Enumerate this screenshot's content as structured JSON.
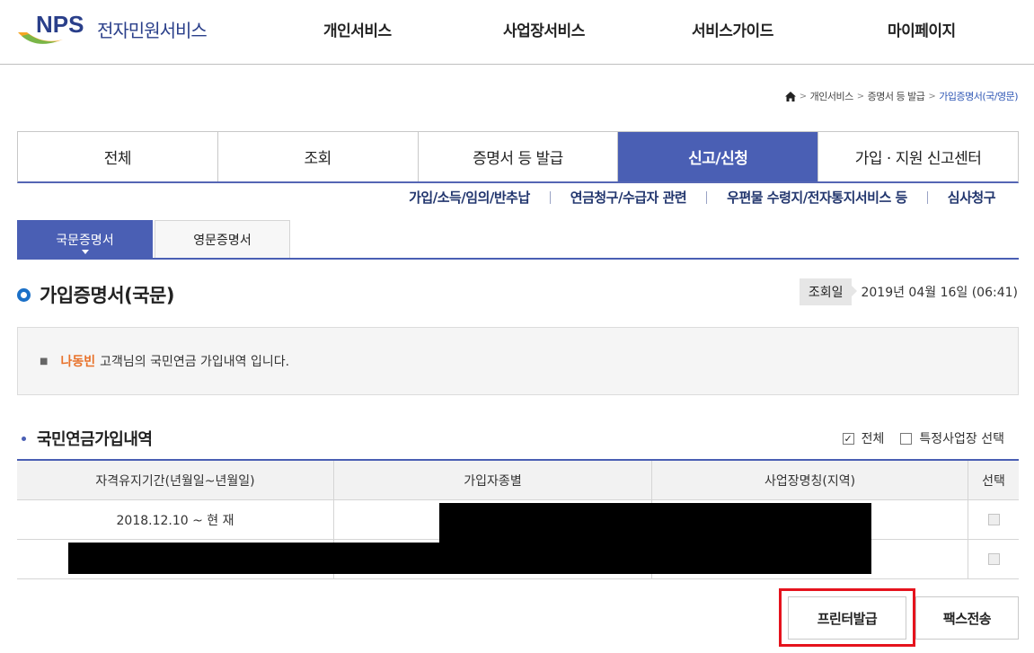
{
  "header": {
    "logo_mark": "NPS",
    "logo_text": "전자민원서비스",
    "nav": [
      "개인서비스",
      "사업장서비스",
      "서비스가이드",
      "마이페이지"
    ]
  },
  "breadcrumb": {
    "items": [
      "개인서비스",
      "증명서 등 발급"
    ],
    "current": "가입증명서(국/영문)"
  },
  "main_tabs": [
    {
      "label": "전체",
      "active": false
    },
    {
      "label": "조회",
      "active": false
    },
    {
      "label": "증명서 등 발급",
      "active": false
    },
    {
      "label": "신고/신청",
      "active": true
    },
    {
      "label": "가입 · 지원 신고센터",
      "active": false
    }
  ],
  "sub_menu": [
    "가입/소득/임의/반추납",
    "연금청구/수급자 관련",
    "우편물 수령지/전자통지서비스 등",
    "심사청구"
  ],
  "cert_tabs": [
    {
      "label": "국문증명서",
      "active": true
    },
    {
      "label": "영문증명서",
      "active": false
    }
  ],
  "page": {
    "title": "가입증명서(국문)",
    "date_label": "조회일",
    "date_value": "2019년 04월 16일 (06:41)"
  },
  "info": {
    "name": "나동빈",
    "message": "고객님의 국민연금 가입내역 입니다."
  },
  "section": {
    "title": "국민연금가입내역",
    "check_all_label": "전체",
    "check_all_checked": true,
    "check_specific_label": "특정사업장 선택",
    "check_specific_checked": false
  },
  "table": {
    "headers": [
      "자격유지기간(년월일~년월일)",
      "가입자종별",
      "사업장명칭(지역)",
      "선택"
    ],
    "rows": [
      [
        "2018.12.10 ~ 현 재",
        "",
        "",
        ""
      ],
      [
        "",
        "",
        "",
        ""
      ]
    ]
  },
  "buttons": {
    "print": "프린터발급",
    "fax": "팩스전송"
  },
  "colors": {
    "primary": "#4a5fb4",
    "accent_orange": "#e8722b",
    "highlight_red": "#e5131d"
  }
}
